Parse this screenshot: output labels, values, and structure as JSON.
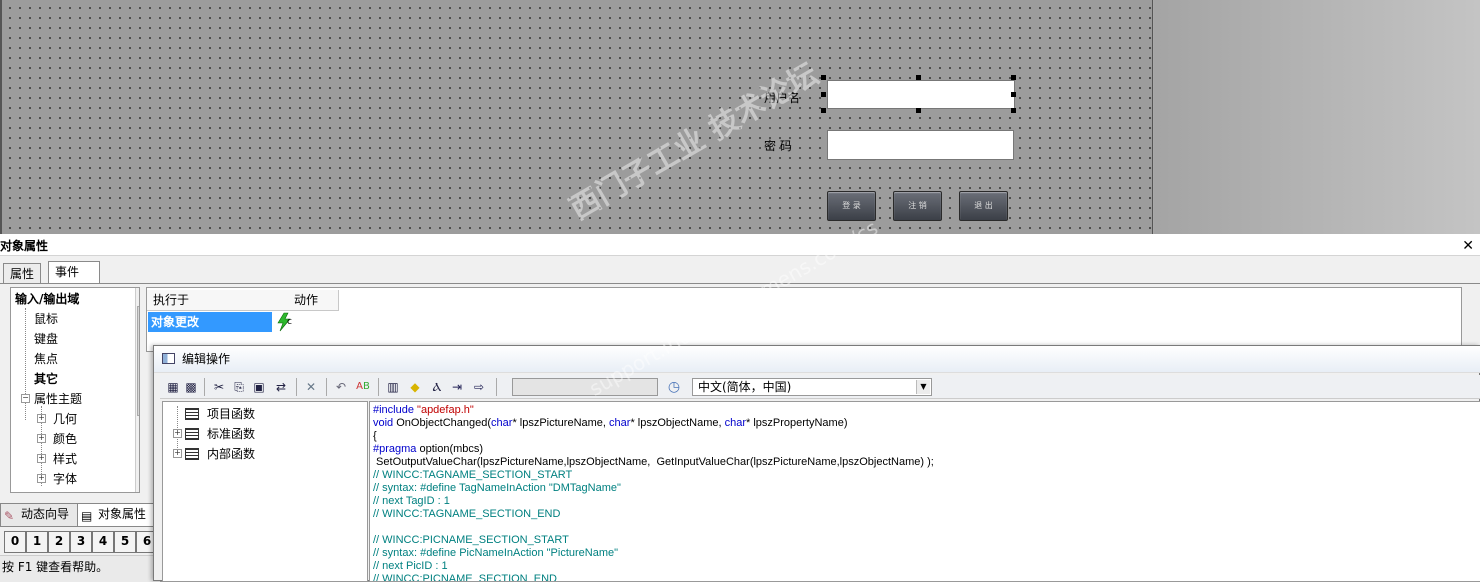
{
  "canvas": {
    "username_label": "用户名",
    "password_label": "密 码",
    "login_button": "登 录",
    "logout_button": "注 销",
    "exit_button": "退 出"
  },
  "props_panel": {
    "title": "对象属性",
    "close": "✕",
    "tabs": [
      "属性",
      "事件"
    ],
    "tree": [
      "输入/输出域",
      "鼠标",
      "键盘",
      "焦点",
      "其它",
      "属性主题",
      "几何",
      "颜色",
      "样式",
      "字体"
    ],
    "table_headers": [
      "执行于",
      "动作"
    ],
    "row_event": "对象更改",
    "row_action_letter": "c",
    "bottom_tabs": [
      "动态向导",
      "对象属性"
    ],
    "layer_numbers": [
      "0",
      "1",
      "2",
      "3",
      "4",
      "5",
      "6"
    ],
    "status": "按 F1 键查看帮助。"
  },
  "dialog": {
    "title": "编辑操作",
    "language": "中文(简体，中国)",
    "func_tree": [
      "项目函数",
      "标准函数",
      "内部函数"
    ],
    "code": [
      [
        {
          "t": "#include ",
          "c": "kw"
        },
        {
          "t": "\"apdefap.h\"",
          "c": "str"
        }
      ],
      [
        {
          "t": "void",
          "c": "kw"
        },
        {
          "t": " OnObjectChanged(",
          "c": ""
        },
        {
          "t": "char",
          "c": "kw"
        },
        {
          "t": "* lpszPictureName, ",
          "c": ""
        },
        {
          "t": "char",
          "c": "kw"
        },
        {
          "t": "* lpszObjectName, ",
          "c": ""
        },
        {
          "t": "char",
          "c": "kw"
        },
        {
          "t": "* lpszPropertyName)",
          "c": ""
        }
      ],
      [
        {
          "t": "{",
          "c": ""
        }
      ],
      [
        {
          "t": "#pragma",
          "c": "kw"
        },
        {
          "t": " option(mbcs)",
          "c": ""
        }
      ],
      [
        {
          "t": " SetOutputValueChar(lpszPictureName,lpszObjectName,  GetInputValueChar(lpszPictureName,lpszObjectName) );",
          "c": ""
        }
      ],
      [
        {
          "t": "// WINCC:TAGNAME_SECTION_START",
          "c": "cm"
        }
      ],
      [
        {
          "t": "// syntax: #define TagNameInAction \"DMTagName\"",
          "c": "cm"
        }
      ],
      [
        {
          "t": "// next TagID : 1",
          "c": "cm"
        }
      ],
      [
        {
          "t": "// WINCC:TAGNAME_SECTION_END",
          "c": "cm"
        }
      ],
      [
        {
          "t": "",
          "c": ""
        }
      ],
      [
        {
          "t": "// WINCC:PICNAME_SECTION_START",
          "c": "cm"
        }
      ],
      [
        {
          "t": "// syntax: #define PicNameInAction \"PictureName\"",
          "c": "cm"
        }
      ],
      [
        {
          "t": "// next PicID : 1",
          "c": "cm"
        }
      ],
      [
        {
          "t": "// WINCC:PICNAME_SECTION_END",
          "c": "cm"
        }
      ]
    ]
  },
  "watermark": {
    "line1": "西门子工业 技术论坛",
    "line2": "support.industry.siemens.com/cs"
  },
  "colors": {
    "selection_blue": "#3399ff",
    "keyword_blue": "#0000cc",
    "string_red": "#c00000",
    "comment_teal": "#008080"
  },
  "icons": [
    "lightning-icon",
    "undo-icon",
    "cut-icon",
    "delete-icon",
    "clock-icon",
    "dropdown-arrow-icon",
    "close-icon"
  ]
}
